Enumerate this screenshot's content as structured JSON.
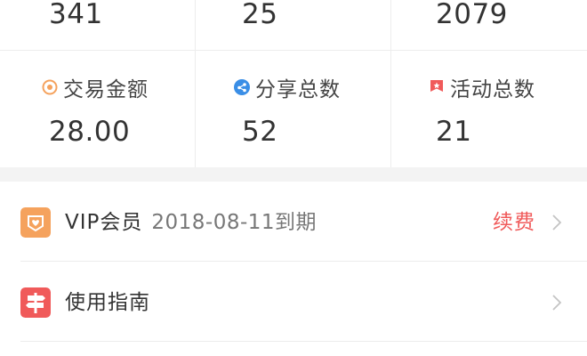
{
  "stats": {
    "row1": [
      {
        "value": "341"
      },
      {
        "value": "25"
      },
      {
        "value": "2079"
      }
    ],
    "row2": [
      {
        "label": "交易金额",
        "value": "28.00",
        "icon": "coin-icon",
        "icon_color": "#f5a25d"
      },
      {
        "label": "分享总数",
        "value": "52",
        "icon": "share-icon",
        "icon_color": "#3a8ee6"
      },
      {
        "label": "活动总数",
        "value": "21",
        "icon": "flag-icon",
        "icon_color": "#f05a5a"
      }
    ]
  },
  "menu": {
    "vip": {
      "title": "VIP会员",
      "subtitle": "2018-08-11到期",
      "action": "续费",
      "icon": "vip-heart-icon",
      "icon_color": "#f5a25d"
    },
    "guide": {
      "title": "使用指南",
      "icon": "guide-signpost-icon",
      "icon_color": "#f05a5a"
    }
  },
  "colors": {
    "accent_red": "#f05a5a",
    "divider": "#ededed",
    "gap_bg": "#f3f3f3"
  }
}
